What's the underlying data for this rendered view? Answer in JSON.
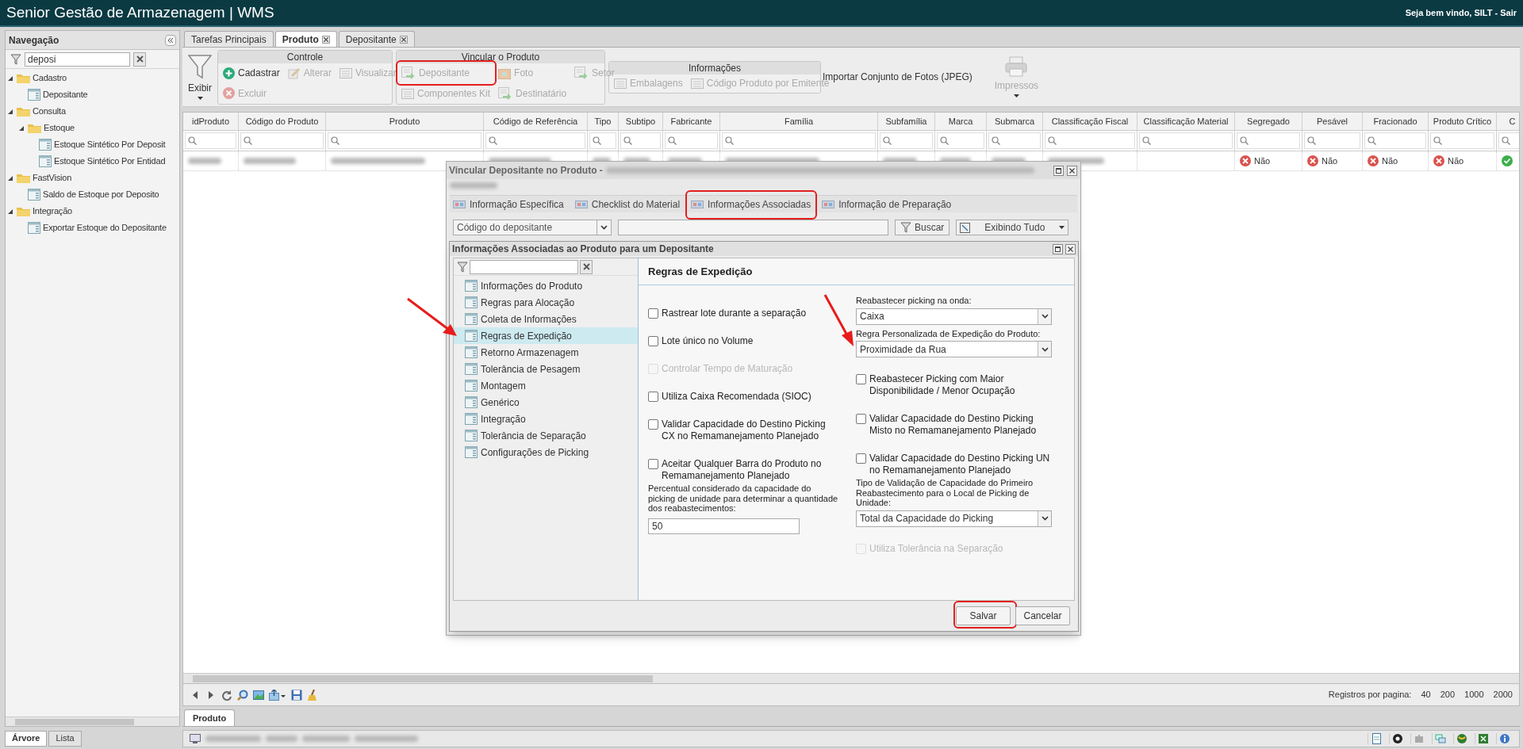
{
  "app": {
    "title": "Senior Gestão de Armazenagem | WMS",
    "welcome": "Seja bem vindo, SILT -",
    "logout": "Sair"
  },
  "navigation": {
    "title": "Navegação",
    "search": {
      "value": "deposi"
    },
    "tree": [
      {
        "label": "Cadastro",
        "kind": "folder",
        "expanded": true,
        "children": [
          {
            "label": "Depositante",
            "kind": "screen"
          }
        ]
      },
      {
        "label": "Consulta",
        "kind": "folder",
        "expanded": true,
        "children": [
          {
            "label": "Estoque",
            "kind": "folder",
            "expanded": true,
            "children": [
              {
                "label": "Estoque Sintético Por Deposit",
                "kind": "screen"
              },
              {
                "label": "Estoque Sintético Por Entidad",
                "kind": "screen"
              }
            ]
          }
        ]
      },
      {
        "label": "FastVision",
        "kind": "folder",
        "expanded": true,
        "children": [
          {
            "label": "Saldo de Estoque por Deposito",
            "kind": "screen"
          }
        ]
      },
      {
        "label": "Integração",
        "kind": "folder",
        "expanded": true,
        "children": [
          {
            "label": "Exportar Estoque do Depositante",
            "kind": "screen"
          }
        ]
      }
    ],
    "bottom_tabs": [
      {
        "label": "Árvore",
        "selected": true
      },
      {
        "label": "Lista",
        "selected": false
      }
    ]
  },
  "tabs": [
    {
      "label": "Tarefas Principais",
      "selected": false,
      "closable": false
    },
    {
      "label": "Produto",
      "selected": true,
      "closable": true
    },
    {
      "label": "Depositante",
      "selected": false,
      "closable": true
    }
  ],
  "toolbar": {
    "filter_button": "Exibir",
    "groups": [
      {
        "title": "Controle",
        "buttons": [
          {
            "label": "Cadastrar",
            "disabled": false
          },
          {
            "label": "Alterar",
            "disabled": true
          },
          {
            "label": "Visualizar",
            "disabled": true
          },
          {
            "label": "Excluir",
            "disabled": true
          }
        ]
      },
      {
        "title": "Vincular o Produto",
        "buttons": [
          {
            "label": "Depositante",
            "disabled": true,
            "highlighted": true
          },
          {
            "label": "Foto",
            "disabled": true
          },
          {
            "label": "Setor",
            "disabled": true
          },
          {
            "label": "Componentes Kit",
            "disabled": true
          },
          {
            "label": "Destinatário",
            "disabled": true
          }
        ]
      },
      {
        "title": "Informações",
        "buttons": [
          {
            "label": "Embalagens",
            "disabled": true
          },
          {
            "label": "Código Produto por Emitente",
            "disabled": true
          }
        ]
      }
    ],
    "import_button": "Importar Conjunto de Fotos (JPEG)",
    "print_button": {
      "label": "Impressos",
      "disabled": true
    }
  },
  "grid": {
    "columns": [
      "idProduto",
      "Código do Produto",
      "Produto",
      "Código de Referência",
      "Tipo",
      "Subtipo",
      "Fabricante",
      "Família",
      "Subfamília",
      "Marca",
      "Submarca",
      "Classificação Fiscal",
      "Classificação Material",
      "Segregado",
      "Pesável",
      "Fracionado",
      "Produto Crítico",
      "C"
    ],
    "rows": [
      {
        "flags": [
          {
            "label": "Não",
            "value": false
          },
          {
            "label": "Não",
            "value": false
          },
          {
            "label": "Não",
            "value": false
          },
          {
            "label": "Não",
            "value": false
          },
          {
            "value": true
          }
        ]
      }
    ]
  },
  "pager": {
    "label": "Registros por pagina:",
    "sizes": [
      "40",
      "200",
      "1000",
      "2000"
    ]
  },
  "bottom_tabs": [
    {
      "label": "Produto",
      "selected": true
    }
  ],
  "link_dialog": {
    "title": "Vincular Depositante no Produto -",
    "actions": [
      {
        "label": "Informação Específica"
      },
      {
        "label": "Checklist do Material"
      },
      {
        "label": "Informações Associadas",
        "highlighted": true
      },
      {
        "label": "Informação de Preparação"
      }
    ],
    "search_field": "Código do depositante",
    "search_button": "Buscar",
    "view_button": "Exibindo Tudo"
  },
  "info_dialog": {
    "title": "Informações Associadas ao Produto para um Depositante",
    "sections": [
      {
        "label": "Informações do Produto",
        "selected": false
      },
      {
        "label": "Regras para Alocação",
        "selected": false
      },
      {
        "label": "Coleta de Informações",
        "selected": false
      },
      {
        "label": "Regras de Expedição",
        "selected": true,
        "arrow": true
      },
      {
        "label": "Retorno Armazenagem",
        "selected": false
      },
      {
        "label": "Tolerância de Pesagem",
        "selected": false
      },
      {
        "label": "Montagem",
        "selected": false
      },
      {
        "label": "Genérico",
        "selected": false
      },
      {
        "label": "Integração",
        "selected": false
      },
      {
        "label": "Tolerância de Separação",
        "selected": false
      },
      {
        "label": "Configurações de Picking",
        "selected": false
      }
    ],
    "panel": {
      "title": "Regras de Expedição",
      "left": [
        {
          "kind": "checkbox",
          "label": "Rastrear lote durante a separação",
          "checked": false,
          "disabled": false
        },
        {
          "kind": "checkbox",
          "label": "Lote único no Volume",
          "checked": false,
          "disabled": false
        },
        {
          "kind": "checkbox",
          "label": "Controlar Tempo de Maturação",
          "checked": false,
          "disabled": true
        },
        {
          "kind": "checkbox",
          "label": "Utiliza Caixa Recomendada (SIOC)",
          "checked": false,
          "disabled": false
        },
        {
          "kind": "checkbox",
          "label": "Validar Capacidade do Destino Picking CX no Remamanejamento Planejado",
          "checked": false,
          "disabled": false
        },
        {
          "kind": "checkbox",
          "label": "Aceitar Qualquer Barra do Produto no Remamanejamento Planejado",
          "checked": false,
          "disabled": false
        },
        {
          "kind": "input",
          "label": "Percentual considerado da capacidade do picking de unidade para determinar a quantidade dos reabastecimentos:",
          "value": "50"
        }
      ],
      "right": [
        {
          "kind": "select",
          "label": "Reabastecer picking na onda:",
          "value": "Caixa"
        },
        {
          "kind": "select",
          "label": "Regra Personalizada de Expedição do Produto:",
          "value": "Proximidade da Rua",
          "arrow": true
        },
        {
          "kind": "checkbox",
          "label": "Reabastecer Picking com Maior Disponibilidade / Menor Ocupação",
          "checked": false,
          "disabled": false
        },
        {
          "kind": "checkbox",
          "label": "Validar Capacidade do Destino Picking Misto no Remamanejamento Planejado",
          "checked": false,
          "disabled": false
        },
        {
          "kind": "checkbox",
          "label": "Validar Capacidade do Destino Picking UN no Remamanejamento Planejado",
          "checked": false,
          "disabled": false
        },
        {
          "kind": "select",
          "label": "Tipo de Validação de Capacidade do Primeiro Reabastecimento para o Local de Picking de Unidade:",
          "value": "Total da Capacidade do Picking"
        },
        {
          "kind": "checkbox",
          "label": "Utiliza Tolerância na Separação",
          "checked": false,
          "disabled": true
        }
      ]
    },
    "buttons": [
      {
        "label": "Salvar",
        "highlighted": true
      },
      {
        "label": "Cancelar"
      }
    ]
  }
}
